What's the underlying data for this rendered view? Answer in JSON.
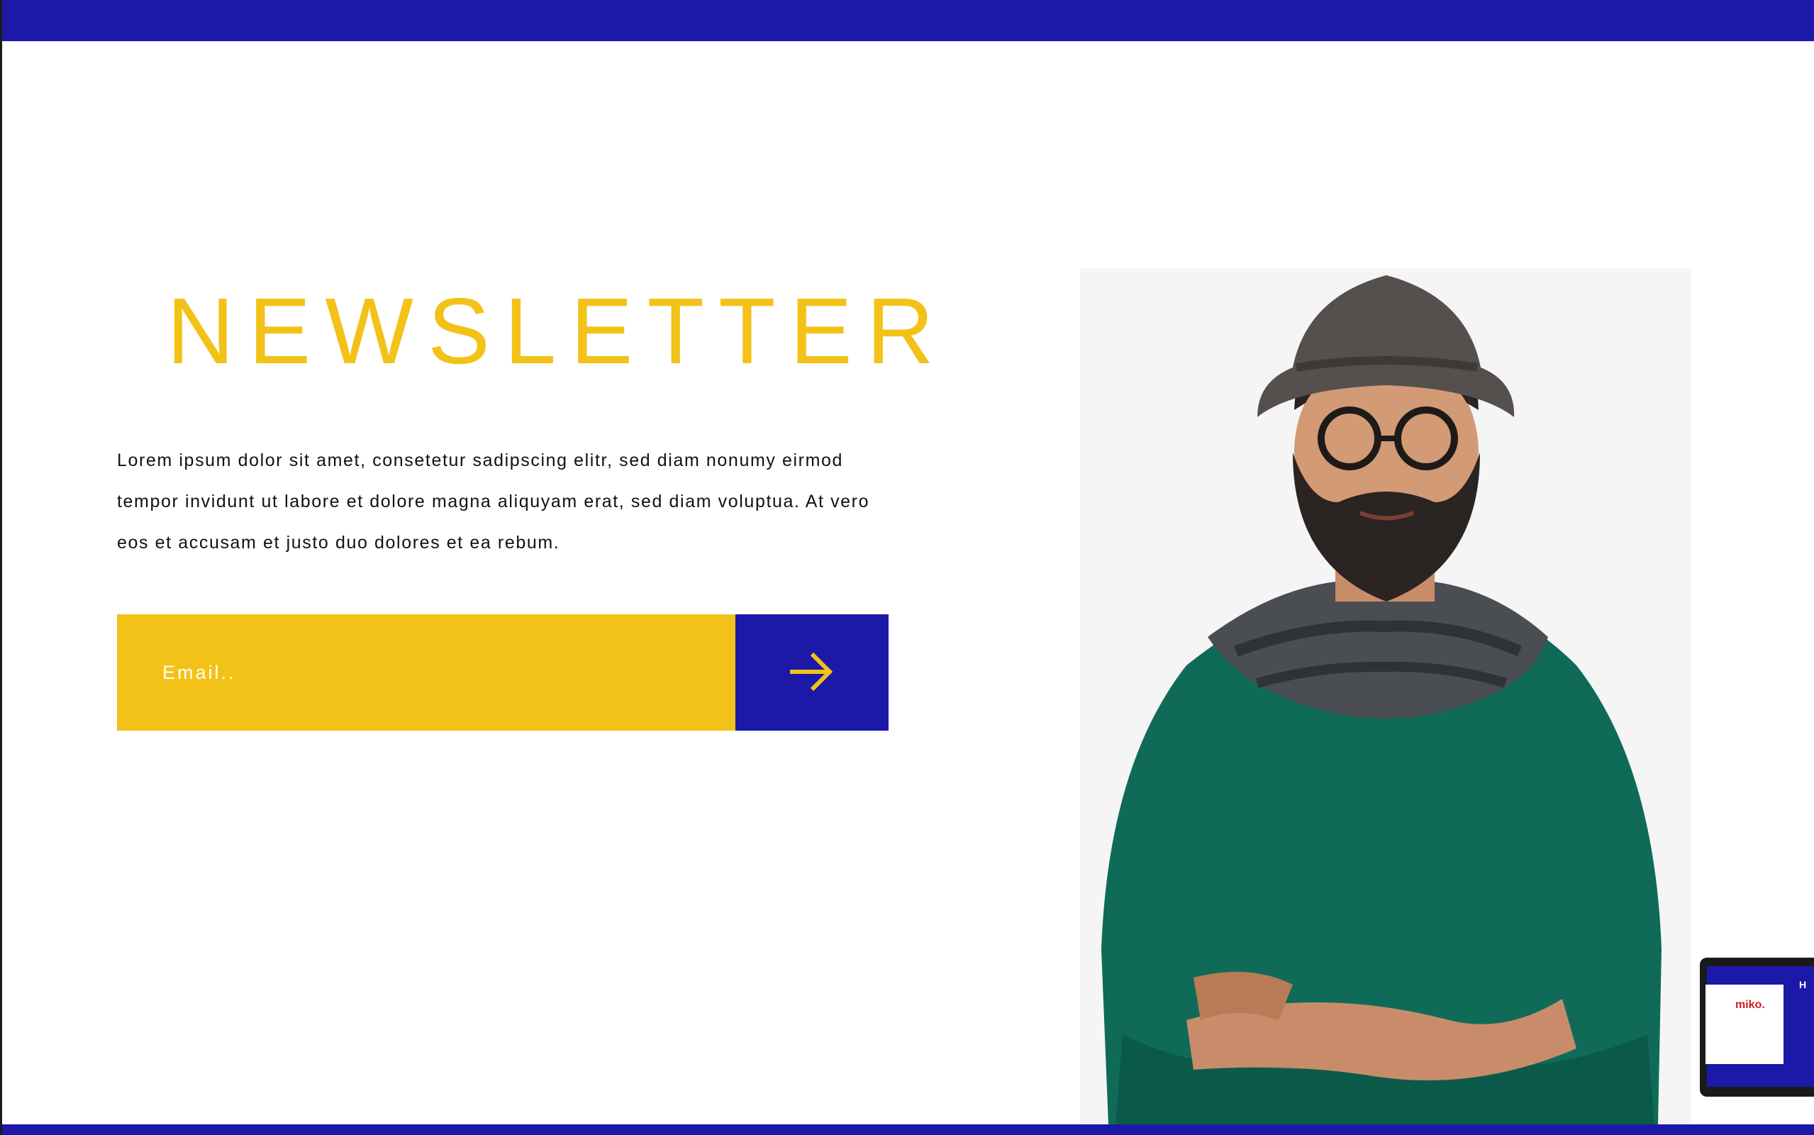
{
  "newsletter": {
    "title": "NEWSLETTER",
    "description": "Lorem ipsum dolor sit amet, consetetur sadipscing elitr, sed diam nonumy eirmod tempor invidunt ut labore et dolore magna aliquyam erat, sed diam voluptua. At vero eos et accusam et justo duo dolores et ea rebum.",
    "email_placeholder": "Email..",
    "submit_icon": "arrow-right-icon"
  },
  "thumbnail": {
    "logo_text": "miko.",
    "side_letter": "H"
  },
  "colors": {
    "primary_blue": "#1c18a8",
    "accent_yellow": "#f2c218",
    "text_dark": "#111111",
    "photo_background": "#f5f5f5"
  }
}
